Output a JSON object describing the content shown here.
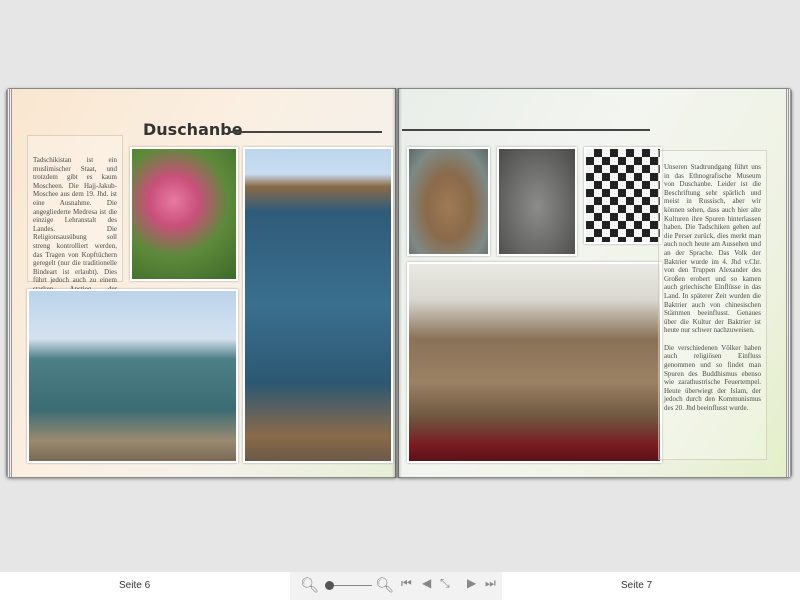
{
  "book": {
    "title": "Duschanbe",
    "left_text": "Tadschikistan ist ein muslimischer Staat, und trotzdem gibt es kaum Moscheen. Die Hajj-Jakub-Moschee aus dem 19. Jhd. ist eine Ausnahme. Die angegliederte Medresa ist die einzige Lehranstalt des Landes. Die Religionsausübung soll streng kontrolliert werden, das Tragen von Kopftüchern geregelt (nur die traditionelle Bindeart ist erlaubt). Dies führt jedoch auch zu einem starken Anstieg der Extremisten.",
    "right_text_1": "Unseren Stadtrundgang führt uns in das Ethnografische Museum von Duschanbe. Leider ist die Beschriftung sehr spärlich und meist in Russisch, aber wir können sehen, dass auch hier alte Kulturen ihre Spuren hinterlassen haben. Die Tadschiken gehen auf die Perser zurück, dies merkt man auch noch heute am Aussehen und an der Sprache. Das Volk der Baktrier wurde im 4. Jhd v.Chr. von den Truppen Alexander des Großen erobert und so kamen auch griechische Einflüsse in das Land. In späterer Zeit wurden die Baktrier auch von chinesischen Stämmen beeinflusst. Genaues über die Kultur der Baktrier ist heute nur schwer nachzuweisen.",
    "right_text_2": "Die verschiedenen Völker haben auch religiösen Einfluss genommen und so findet man Spuren des Buddhismus ebenso wie zarathustrische Feuertempel. Heute überwiegt der Islam, der jedoch durch den Kommunismus des 20. Jhd beeinflusst wurde."
  },
  "footer": {
    "left_page": "Seite 6",
    "right_page": "Seite 7",
    "zoom_level": 0.1,
    "icons": [
      "zoom-out-icon",
      "zoom-in-icon",
      "first-page-icon",
      "prev-page-icon",
      "fit-icon",
      "next-page-icon",
      "last-page-icon"
    ]
  }
}
